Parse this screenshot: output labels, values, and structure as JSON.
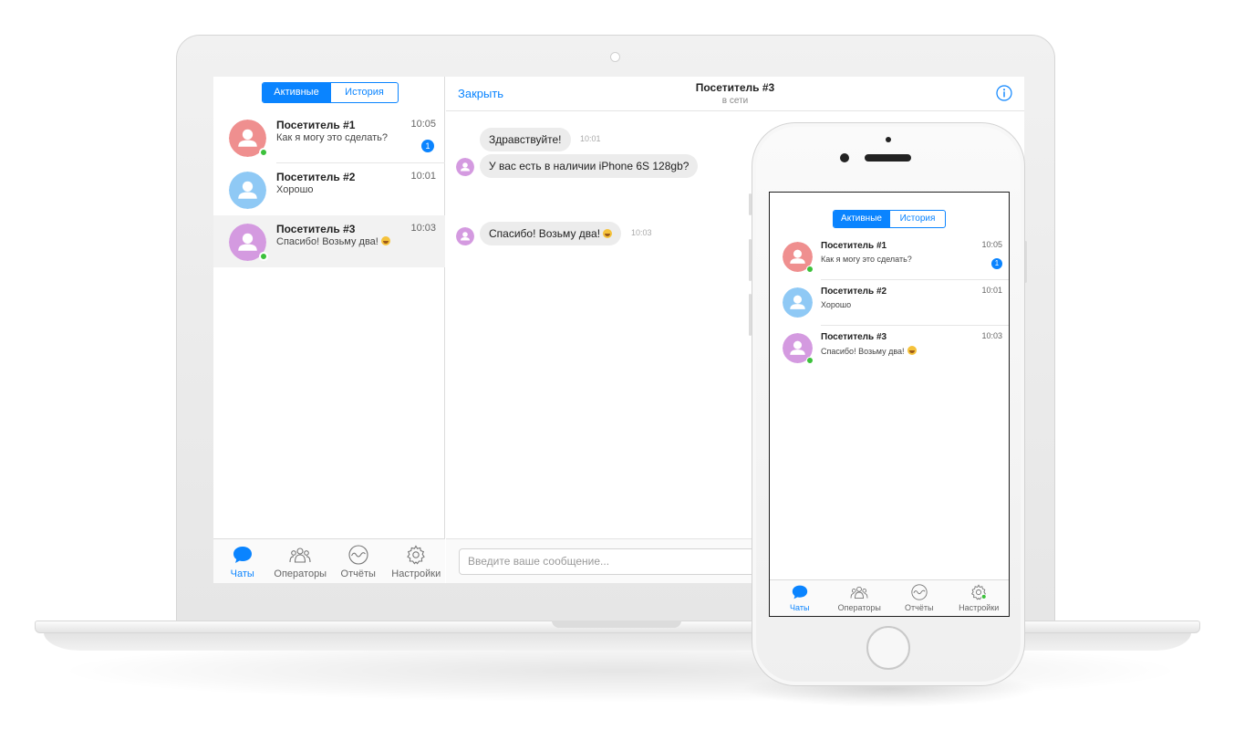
{
  "colors": {
    "accent": "#0a84ff",
    "online": "#3cc13b",
    "avatar_1": "#ef8f8f",
    "avatar_2": "#8fc9f5",
    "avatar_3": "#d49ae0"
  },
  "laptop": {
    "segment": {
      "active_label": "Активные",
      "history_label": "История"
    },
    "chats": [
      {
        "name": "Посетитель #1",
        "message": "Как я могу это сделать?",
        "time": "10:05",
        "badge": "1",
        "online": true
      },
      {
        "name": "Посетитель #2",
        "message": "Хорошо",
        "time": "10:01",
        "online": false
      },
      {
        "name": "Посетитель #3",
        "message": "Спасибо! Возьму два!",
        "emoji": "grinning-face-emoji",
        "time": "10:03",
        "online": true,
        "selected": true
      }
    ],
    "tabs": [
      {
        "label": "Чаты",
        "icon": "chat-bubble-icon",
        "active": true
      },
      {
        "label": "Операторы",
        "icon": "operators-icon"
      },
      {
        "label": "Отчёты",
        "icon": "reports-icon"
      },
      {
        "label": "Настройки",
        "icon": "gear-icon"
      }
    ],
    "conversation": {
      "close_label": "Закрыть",
      "title": "Посетитель #3",
      "status": "в сети",
      "info_icon": "info-icon",
      "messages": [
        {
          "text": "Здравствуйте!",
          "time": "10:01"
        },
        {
          "text": "У вас есть в наличии iPhone 6S 128gb?"
        },
        {
          "text": "Спасибо! Возьму два!",
          "emoji": "grinning-face-emoji",
          "time": "10:03"
        }
      ],
      "input_placeholder": "Введите ваше сообщение..."
    }
  },
  "phone": {
    "segment": {
      "active_label": "Активные",
      "history_label": "История"
    },
    "chats": [
      {
        "name": "Посетитель #1",
        "message": "Как я могу это сделать?",
        "time": "10:05",
        "badge": "1",
        "online": true
      },
      {
        "name": "Посетитель #2",
        "message": "Хорошо",
        "time": "10:01",
        "online": false
      },
      {
        "name": "Посетитель #3",
        "message": "Спасибо! Возьму два!",
        "emoji": "grinning-face-emoji",
        "time": "10:03",
        "online": true
      }
    ],
    "tabs": [
      {
        "label": "Чаты",
        "icon": "chat-bubble-icon",
        "active": true
      },
      {
        "label": "Операторы",
        "icon": "operators-icon"
      },
      {
        "label": "Отчёты",
        "icon": "reports-icon"
      },
      {
        "label": "Настройки",
        "icon": "gear-icon"
      }
    ]
  }
}
